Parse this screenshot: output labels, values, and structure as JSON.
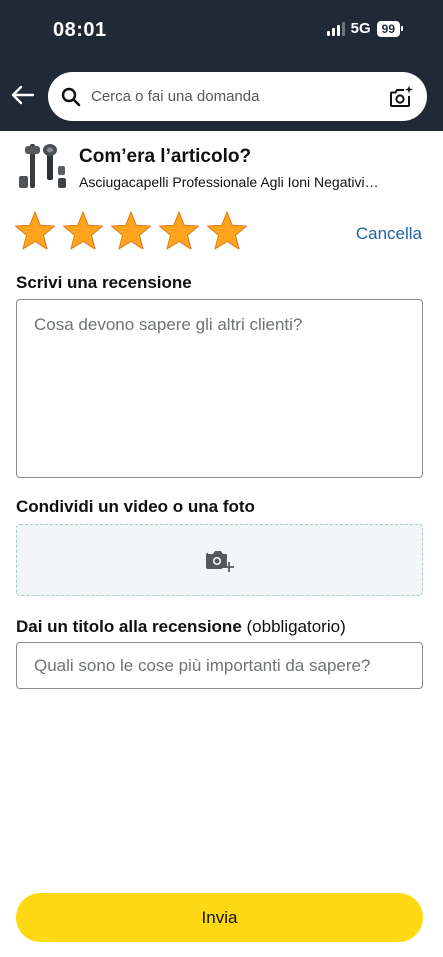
{
  "status_bar": {
    "time": "08:01",
    "network": "5G",
    "battery": "99",
    "signal_bars_filled": 3,
    "signal_bars_total": 4
  },
  "header": {
    "back_icon": "arrow-left-icon",
    "search_placeholder": "Cerca o fai una domanda",
    "search_icon": "search-icon",
    "camera_icon": "camera-sparkle-icon",
    "background_color": "#1f2a36"
  },
  "product": {
    "heading": "Com’era l’articolo?",
    "name": "Asciugacapelli Professionale Agli Ioni Negativi…"
  },
  "rating": {
    "value": 5,
    "max": 5,
    "star_color": "#ffa41c",
    "clear_label": "Cancella"
  },
  "review": {
    "label": "Scrivi una recensione",
    "placeholder": "Cosa devono sapere gli altri clienti?"
  },
  "media": {
    "label": "Condividi un video o una foto",
    "icon": "camera-add-icon"
  },
  "title_field": {
    "label": "Dai un titolo alla recensione",
    "label_suffix": "(obbligatorio)",
    "placeholder": "Quali sono le cose più importanti da sapere?"
  },
  "submit": {
    "label": "Invia",
    "color": "#ffd814"
  }
}
